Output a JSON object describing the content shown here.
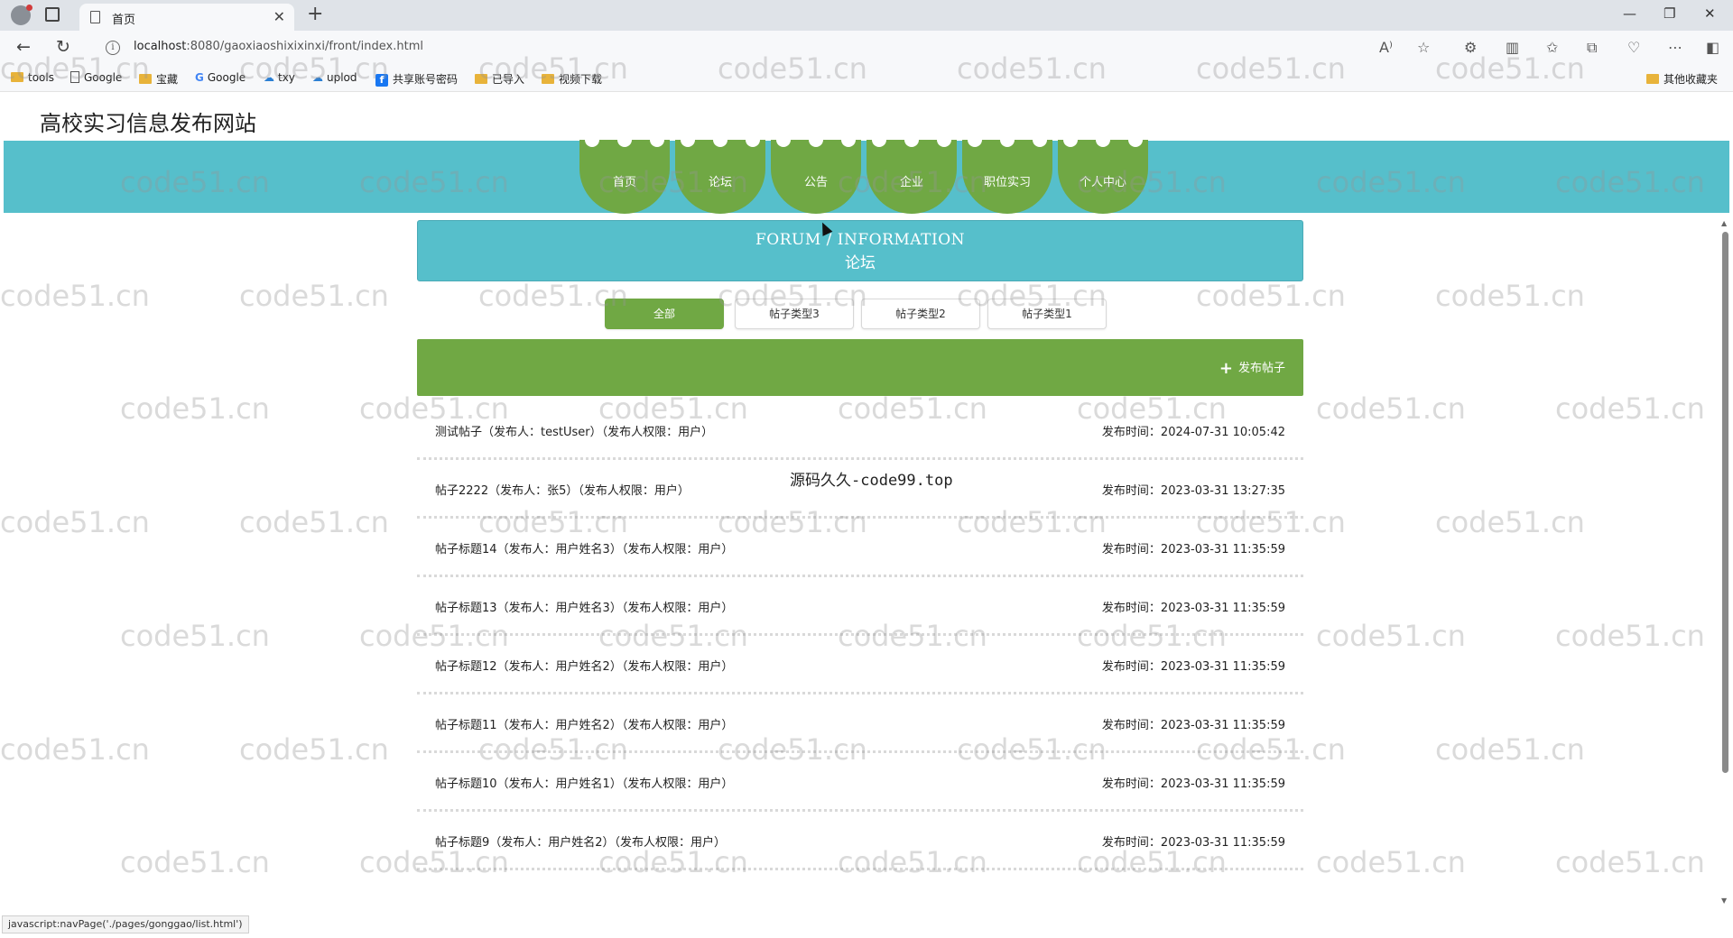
{
  "browser": {
    "tab_title": "首页",
    "url_host": "localhost",
    "url_path": ":8080/gaoxiaoshixixinxi/front/index.html",
    "bookmarks": [
      "tools",
      "Google",
      "宝藏",
      "Google",
      "txy",
      "uplod",
      "共享账号密码",
      "已导入",
      "视频下载"
    ],
    "other_bookmarks": "其他收藏夹",
    "status_text": "javascript:navPage('./pages/gonggao/list.html')"
  },
  "site": {
    "title": "高校实习信息发布网站",
    "nav": [
      "首页",
      "论坛",
      "公告",
      "企业",
      "职位实习",
      "个人中心"
    ]
  },
  "section": {
    "title_en": "FORUM / INFORMATION",
    "title_zh": "论坛"
  },
  "filters": {
    "items": [
      "全部",
      "帖子类型3",
      "帖子类型2",
      "帖子类型1"
    ],
    "active": "全部"
  },
  "publish_label": "发布帖子",
  "posts": [
    {
      "title": "测试帖子（发布人：testUser）（发布人权限：用户）",
      "time": "发布时间：2024-07-31 10:05:42"
    },
    {
      "title": "帖子2222（发布人：张5）（发布人权限：用户）",
      "time": "发布时间：2023-03-31 13:27:35"
    },
    {
      "title": "帖子标题14（发布人：用户姓名3）（发布人权限：用户）",
      "time": "发布时间：2023-03-31 11:35:59"
    },
    {
      "title": "帖子标题13（发布人：用户姓名3）（发布人权限：用户）",
      "time": "发布时间：2023-03-31 11:35:59"
    },
    {
      "title": "帖子标题12（发布人：用户姓名2）（发布人权限：用户）",
      "time": "发布时间：2023-03-31 11:35:59"
    },
    {
      "title": "帖子标题11（发布人：用户姓名2）（发布人权限：用户）",
      "time": "发布时间：2023-03-31 11:35:59"
    },
    {
      "title": "帖子标题10（发布人：用户姓名1）（发布人权限：用户）",
      "time": "发布时间：2023-03-31 11:35:59"
    },
    {
      "title": "帖子标题9（发布人：用户姓名2）（发布人权限：用户）",
      "time": "发布时间：2023-03-31 11:35:59"
    }
  ],
  "overlay_text": "源码久久-code99.top",
  "watermark": "code51.cn",
  "colors": {
    "teal": "#56bfcb",
    "green": "#70a844"
  }
}
